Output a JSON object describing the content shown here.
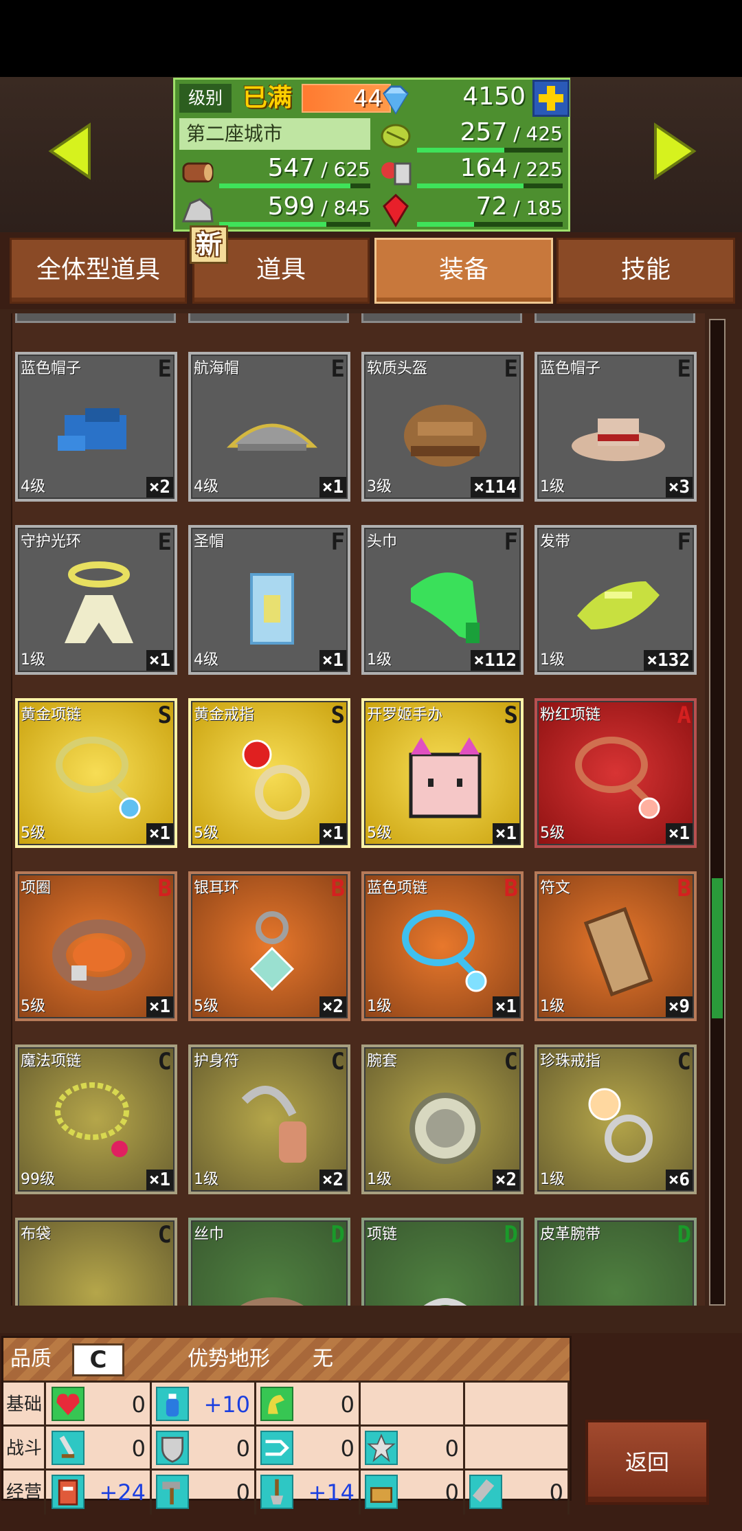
{
  "header": {
    "level_label": "级别",
    "level_max_label": "已满",
    "level_value": "44",
    "gems": "4150",
    "city_name": "第二座城市",
    "resources": {
      "grass": {
        "value": "257",
        "max": "425",
        "fill": 0.6
      },
      "wood": {
        "value": "547",
        "max": "625",
        "fill": 0.87
      },
      "food": {
        "value": "164",
        "max": "225",
        "fill": 0.73
      },
      "ore": {
        "value": "599",
        "max": "845",
        "fill": 0.71
      },
      "ruby": {
        "value": "72",
        "max": "185",
        "fill": 0.39
      }
    },
    "new_badge": "新"
  },
  "tabs": [
    {
      "label": "全体型道具",
      "active": false
    },
    {
      "label": "道具",
      "active": false
    },
    {
      "label": "装备",
      "active": true
    },
    {
      "label": "技能",
      "active": false
    }
  ],
  "items": [
    {
      "name": "蓝色帽子",
      "grade": "E",
      "level": "4级",
      "qty": "×2",
      "rarity": "E",
      "icon": "blue-cap-icon"
    },
    {
      "name": "航海帽",
      "grade": "E",
      "level": "4级",
      "qty": "×1",
      "rarity": "E",
      "icon": "sailor-hat-icon"
    },
    {
      "name": "软质头盔",
      "grade": "E",
      "level": "3级",
      "qty": "×114",
      "rarity": "E",
      "icon": "soft-helmet-icon"
    },
    {
      "name": "蓝色帽子",
      "grade": "E",
      "level": "1级",
      "qty": "×3",
      "rarity": "E",
      "icon": "straw-hat-icon"
    },
    {
      "name": "守护光环",
      "grade": "E",
      "level": "1级",
      "qty": "×1",
      "rarity": "E",
      "icon": "halo-icon"
    },
    {
      "name": "圣帽",
      "grade": "F",
      "level": "4级",
      "qty": "×1",
      "rarity": "E",
      "icon": "holy-hat-icon"
    },
    {
      "name": "头巾",
      "grade": "F",
      "level": "1级",
      "qty": "×112",
      "rarity": "E",
      "icon": "bandana-icon"
    },
    {
      "name": "发带",
      "grade": "F",
      "level": "1级",
      "qty": "×132",
      "rarity": "E",
      "icon": "headband-icon"
    },
    {
      "name": "黄金项链",
      "grade": "S",
      "level": "5级",
      "qty": "×1",
      "rarity": "S",
      "icon": "gold-necklace-icon"
    },
    {
      "name": "黄金戒指",
      "grade": "S",
      "level": "5级",
      "qty": "×1",
      "rarity": "S",
      "icon": "gold-ring-icon"
    },
    {
      "name": "开罗姬手办",
      "grade": "S",
      "level": "5级",
      "qty": "×1",
      "rarity": "S",
      "icon": "figurine-icon"
    },
    {
      "name": "粉红项链",
      "grade": "A",
      "level": "5级",
      "qty": "×1",
      "rarity": "A",
      "icon": "pink-necklace-icon"
    },
    {
      "name": "项圈",
      "grade": "B",
      "level": "5级",
      "qty": "×1",
      "rarity": "B",
      "icon": "collar-icon"
    },
    {
      "name": "银耳环",
      "grade": "B",
      "level": "5级",
      "qty": "×2",
      "rarity": "B",
      "icon": "silver-earring-icon"
    },
    {
      "name": "蓝色项链",
      "grade": "B",
      "level": "1级",
      "qty": "×1",
      "rarity": "B",
      "icon": "blue-necklace-icon"
    },
    {
      "name": "符文",
      "grade": "B",
      "level": "1级",
      "qty": "×9",
      "rarity": "B",
      "icon": "rune-icon"
    },
    {
      "name": "魔法项链",
      "grade": "C",
      "level": "99级",
      "qty": "×1",
      "rarity": "C",
      "icon": "magic-necklace-icon"
    },
    {
      "name": "护身符",
      "grade": "C",
      "level": "1级",
      "qty": "×2",
      "rarity": "C",
      "icon": "amulet-icon"
    },
    {
      "name": "腕套",
      "grade": "C",
      "level": "1级",
      "qty": "×2",
      "rarity": "C",
      "icon": "wristband-icon"
    },
    {
      "name": "珍珠戒指",
      "grade": "C",
      "level": "1级",
      "qty": "×6",
      "rarity": "C",
      "icon": "pearl-ring-icon"
    },
    {
      "name": "布袋",
      "grade": "C",
      "level": "",
      "qty": "",
      "rarity": "C",
      "icon": "cloth-bag-icon"
    },
    {
      "name": "丝巾",
      "grade": "D",
      "level": "",
      "qty": "",
      "rarity": "D",
      "icon": "scarf-icon"
    },
    {
      "name": "项链",
      "grade": "D",
      "level": "",
      "qty": "",
      "rarity": "D",
      "icon": "necklace-icon"
    },
    {
      "name": "皮革腕带",
      "grade": "D",
      "level": "",
      "qty": "",
      "rarity": "D",
      "icon": "leather-strap-icon"
    }
  ],
  "scroll": {
    "position": 0.56
  },
  "info": {
    "quality_label": "品质",
    "quality_value": "C",
    "terrain_label": "优势地形",
    "terrain_value": "无",
    "rows": [
      {
        "label": "基础",
        "stats": [
          {
            "icon": "heart-icon",
            "value": "0"
          },
          {
            "icon": "potion-icon",
            "value": "+10"
          },
          {
            "icon": "strength-icon",
            "value": "0"
          }
        ]
      },
      {
        "label": "战斗",
        "stats": [
          {
            "icon": "sword-icon",
            "value": "0"
          },
          {
            "icon": "shield-icon",
            "value": "0"
          },
          {
            "icon": "speed-icon",
            "value": "0"
          },
          {
            "icon": "star-icon",
            "value": "0"
          }
        ]
      },
      {
        "label": "经营",
        "stats": [
          {
            "icon": "build-icon",
            "value": "+24"
          },
          {
            "icon": "hammer-icon",
            "value": "0"
          },
          {
            "icon": "shovel-icon",
            "value": "+14"
          },
          {
            "icon": "basket-icon",
            "value": "0"
          },
          {
            "icon": "tool-icon",
            "value": "0"
          }
        ]
      }
    ]
  },
  "back_label": "返回",
  "colors": {
    "panel_green": "#4d8f2f",
    "tab_active": "#c8783c",
    "grade_S": "#1a1a1a",
    "grade_A": "#d42020",
    "grade_B": "#d42020",
    "grade_C": "#1a1a1a",
    "grade_D": "#1a9a2a",
    "grade_E": "#1a1a1a",
    "grade_F": "#1a1a1a"
  }
}
